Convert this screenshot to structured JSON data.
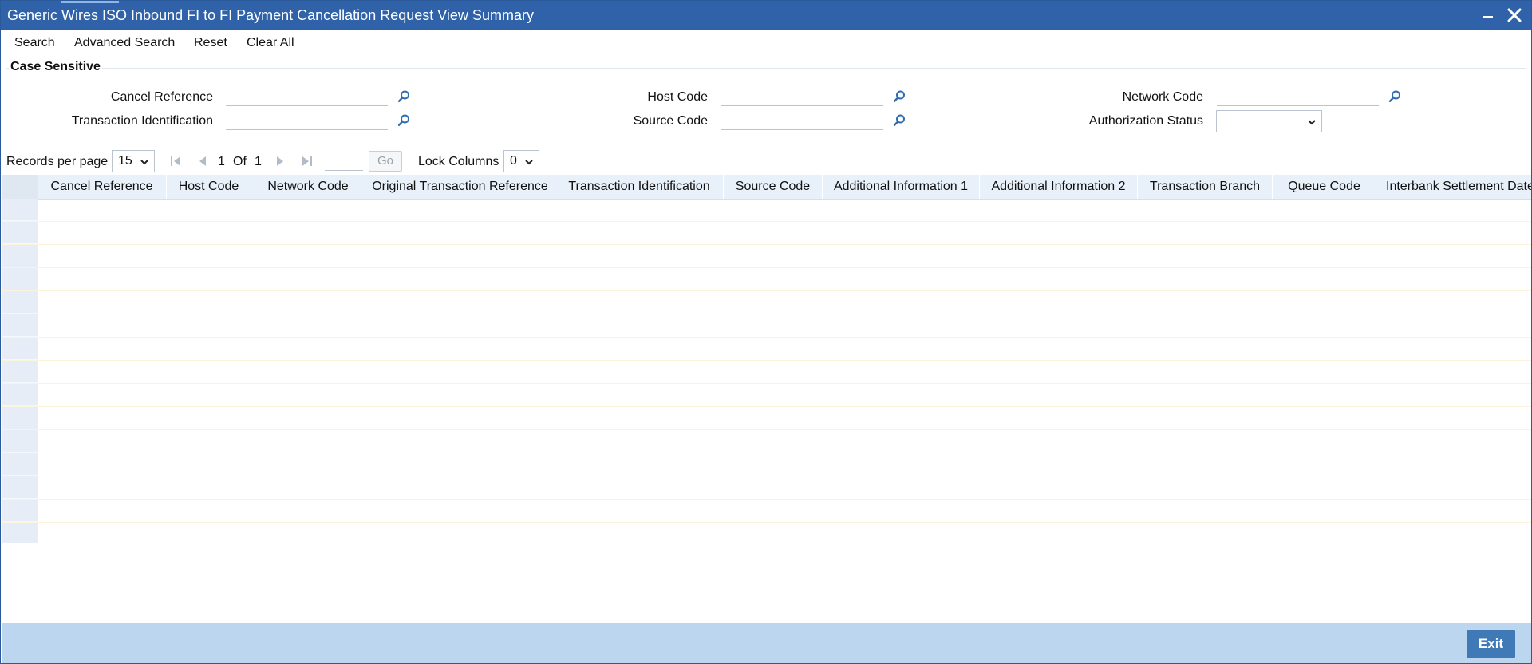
{
  "window": {
    "title": "Generic Wires ISO Inbound FI to FI Payment Cancellation Request View Summary"
  },
  "toolbar": {
    "search": "Search",
    "advanced_search": "Advanced Search",
    "reset": "Reset",
    "clear_all": "Clear All"
  },
  "criteria": {
    "legend": "Case Sensitive",
    "cancel_reference": {
      "label": "Cancel Reference",
      "value": ""
    },
    "transaction_identification": {
      "label": "Transaction Identification",
      "value": ""
    },
    "host_code": {
      "label": "Host Code",
      "value": ""
    },
    "source_code": {
      "label": "Source Code",
      "value": ""
    },
    "network_code": {
      "label": "Network Code",
      "value": ""
    },
    "authorization_status": {
      "label": "Authorization Status",
      "value": ""
    }
  },
  "pager": {
    "records_label": "Records per page",
    "records_value": "15",
    "current_page": "1",
    "of_label": "Of",
    "total_pages": "1",
    "go_label": "Go",
    "lock_label": "Lock Columns",
    "lock_value": "0"
  },
  "grid": {
    "columns": [
      "Cancel Reference",
      "Host Code",
      "Network Code",
      "Original Transaction Reference",
      "Transaction Identification",
      "Source Code",
      "Additional Information 1",
      "Additional Information 2",
      "Transaction Branch",
      "Queue Code",
      "Interbank Settlement Date"
    ],
    "row_count": 15
  },
  "footer": {
    "exit_label": "Exit"
  },
  "colors": {
    "titlebar": "#2f62a8",
    "header_row": "#e8f0f9",
    "footer": "#bcd6ef",
    "exit_button": "#3f79b6",
    "lov_icon": "#2f6bb0"
  }
}
